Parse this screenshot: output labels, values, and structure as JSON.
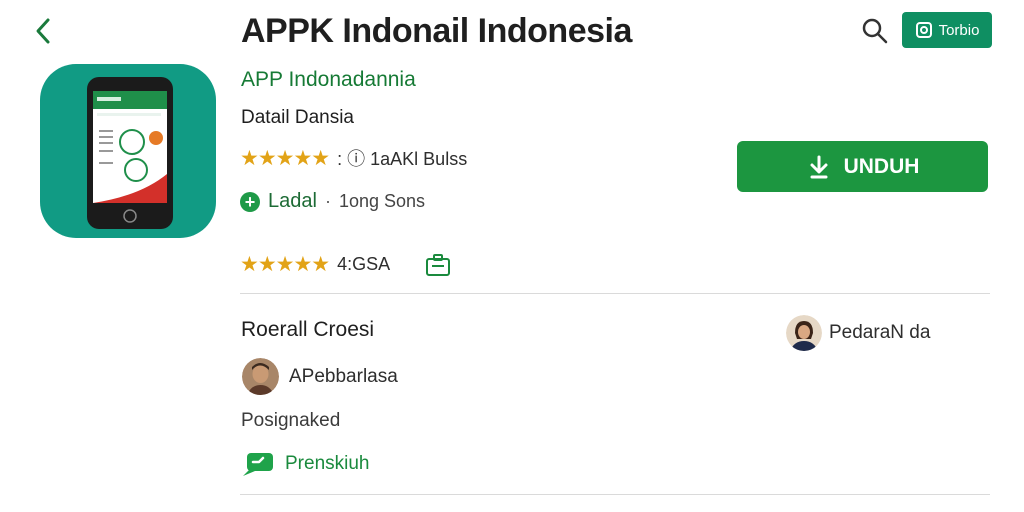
{
  "header": {
    "title": "APPK Indonail Indonesia",
    "top_button_label": "Torbio"
  },
  "app": {
    "developer": "APP Indonadannia",
    "subtitle": "Datail Dansia",
    "rating_stars_1": "★★★★★",
    "rating_meta_1": ": ⓘ 1aAKl Bulss",
    "info_label": "Ladal",
    "info_separator": "·",
    "info_value": "1ong Sons",
    "rating_stars_2": "★★★★★",
    "rating_value_2": "4:GSA",
    "install_label": "UNDUH"
  },
  "reviews": {
    "section_title": "Roerall Croesi",
    "right_reviewer_name": "PedaraN da",
    "left_reviewer_name": "APebbarlasa",
    "review_text": "Posignaked",
    "reply_label": "Prenskiuh"
  },
  "colors": {
    "brand_green": "#1c9640",
    "teal": "#119b84",
    "star": "#e2a317"
  }
}
